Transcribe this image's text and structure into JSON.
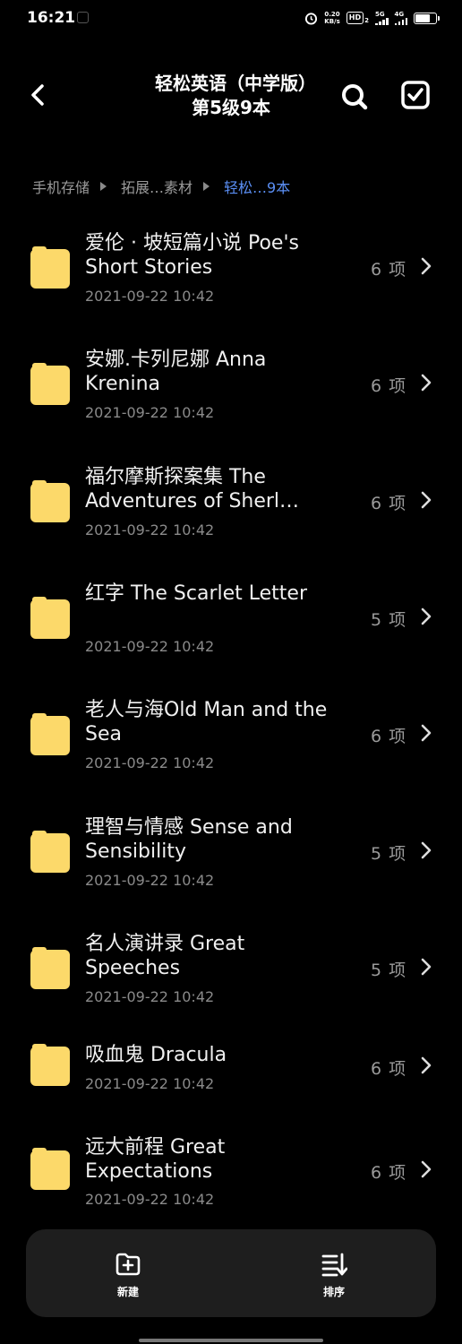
{
  "status_bar": {
    "time": "16:21",
    "net_speed_value": "0.20",
    "net_speed_unit": "KB/s",
    "hd_badge": "HD",
    "hd_sub": "2",
    "net1_label": "5G",
    "net2_label": "4G",
    "battery_level": 0.75
  },
  "header": {
    "title": "轻松英语（中学版）第5级9本",
    "back_icon": "back-arrow-icon",
    "search_icon": "search-icon",
    "select_icon": "checkbox-icon"
  },
  "breadcrumb": [
    "手机存储",
    "拓展…素材",
    "轻松…9本"
  ],
  "folders": [
    {
      "name": "爱伦 · 坡短篇小说 Poe's Short Stories",
      "date": "2021-09-22 10:42",
      "count": "6 项"
    },
    {
      "name": "安娜.卡列尼娜 Anna Krenina",
      "date": "2021-09-22 10:42",
      "count": "6 项"
    },
    {
      "name": "福尔摩斯探案集 The Adventures of Sherl…",
      "date": "2021-09-22 10:42",
      "count": "6 项"
    },
    {
      "name": "红字 The Scarlet Letter",
      "date": "2021-09-22 10:42",
      "count": "5 项"
    },
    {
      "name": "老人与海Old Man and the Sea",
      "date": "2021-09-22 10:42",
      "count": "6 项"
    },
    {
      "name": "理智与情感 Sense and Sensibility",
      "date": "2021-09-22 10:42",
      "count": "5 项"
    },
    {
      "name": "名人演讲录 Great Speeches",
      "date": "2021-09-22 10:42",
      "count": "5 项"
    },
    {
      "name": "吸血鬼 Dracula",
      "date": "2021-09-22 10:42",
      "count": "6 项"
    },
    {
      "name": "远大前程 Great Expectations",
      "date": "2021-09-22 10:42",
      "count": "6 项"
    }
  ],
  "bottom_bar": {
    "new_label": "新建",
    "new_icon": "new-folder-icon",
    "sort_label": "排序",
    "sort_icon": "sort-icon"
  },
  "colors": {
    "background": "#000000",
    "folder": "#fcd96a",
    "breadcrumb_active": "#5b8ff5",
    "bottom_bar": "#1e1e1e"
  }
}
